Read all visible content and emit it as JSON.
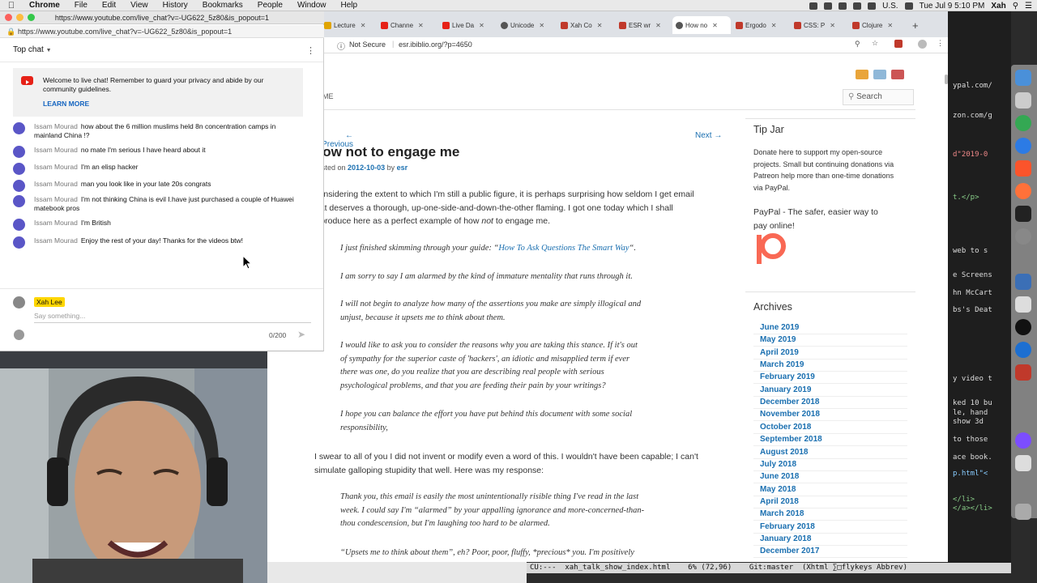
{
  "menubar": {
    "app": "Chrome",
    "items": [
      "File",
      "Edit",
      "View",
      "History",
      "Bookmarks",
      "People",
      "Window",
      "Help"
    ],
    "input_source": "U.S.",
    "clock": "Tue Jul 9  5:10 PM",
    "user": "Xah"
  },
  "chat_window": {
    "title": "https://www.youtube.com/live_chat?v=-UG622_5z80&is_popout=1",
    "url": "https://www.youtube.com/live_chat?v=-UG622_5z80&is_popout=1",
    "header": "Top chat",
    "welcome": "Welcome to live chat! Remember to guard your privacy and abide by our community guidelines.",
    "learn_more": "LEARN MORE",
    "messages": [
      {
        "author": "Issam Mourad",
        "text": "how about the 6 million muslims held 8n concentration camps in mainland China !?"
      },
      {
        "author": "Issam Mourad",
        "text": "no mate I'm serious I have heard about it"
      },
      {
        "author": "Issam Mourad",
        "text": "I'm an elisp hacker"
      },
      {
        "author": "Issam Mourad",
        "text": "man you look like in your late 20s congrats"
      },
      {
        "author": "Issam Mourad",
        "text": "I'm not thinking China is evil I.have just purchased a couple of Huawei matebook pros"
      },
      {
        "author": "Issam Mourad",
        "text": "I'm British"
      },
      {
        "author": "Issam Mourad",
        "text": "Enjoy the rest of your day! Thanks for the videos btw!"
      }
    ],
    "current_user": "Xah Lee",
    "input_placeholder": "Say something...",
    "char_count": "0/200"
  },
  "browser": {
    "tabs": [
      {
        "label": "Lecture",
        "color": "#e0a400"
      },
      {
        "label": "Channe",
        "color": "#e62117"
      },
      {
        "label": "Live Da",
        "color": "#e62117"
      },
      {
        "label": "Unicode",
        "color": "#555555"
      },
      {
        "label": "Xah Co",
        "color": "#c0392b"
      },
      {
        "label": "ESR wr",
        "color": "#c0392b"
      },
      {
        "label": "How no",
        "color": "#555555"
      },
      {
        "label": "Ergodo",
        "color": "#c0392b"
      },
      {
        "label": "CSS: P",
        "color": "#c0392b"
      },
      {
        "label": "Clojure",
        "color": "#c0392b"
      }
    ],
    "security": "Not Secure",
    "url": "esr.ibiblio.org/?p=4650"
  },
  "blog": {
    "nav_partial": "ME",
    "search_label": "Search",
    "prev": "← Previous",
    "next": "Next →",
    "title": "How not to engage me",
    "posted_prefix": "Posted on",
    "date": "2012-10-03",
    "by": "by",
    "author": "esr",
    "intro_1": "Considering the extent to which I'm still a public figure, it is perhaps surprising how seldom I get email",
    "intro_2": "that deserves a thorough, up-one-side-and-down-the-other flaming. I got one today which I shall",
    "intro_3_a": "reproduce here as a perfect example of how",
    "intro_3_em": "not",
    "intro_3_b": "to engage me.",
    "q1_a": "I just finished skimming through your guide: “",
    "q1_link": "How To Ask Questions The Smart Way",
    "q1_b": "“.",
    "q2": "I am sorry to say I am alarmed by the kind of immature mentality that runs through it.",
    "q3_1": "I will not begin to analyze how many of the assertions you make are simply illogical and",
    "q3_2": "unjust, because it upsets me to think about them.",
    "q4_1": "I would like to ask you to consider the reasons why you are taking this stance. If it's out",
    "q4_2": "of sympathy for the superior caste of 'hackers', an idiotic and misapplied term if ever",
    "q4_3": "there was one, do you realize that you are describing real people with serious",
    "q4_4": "psychological problems, and that you are feeding their pain by your writings?",
    "q5_1": "I hope you can balance the effort you have put behind this document with some social",
    "q5_2": "responsibility,",
    "body_1": "I swear to all of you I did not invent or modify even a word of this. I wouldn't have been capable; I can't",
    "body_2": "simulate galloping stupidity that well. Here was my response:",
    "r1_1": "Thank you, this email is easily the most unintentionally risible thing I've read in the last",
    "r1_2": "week. I could say I'm “alarmed” by your appalling ignorance and more-concerned-than-",
    "r1_3": "thou condescension, but I'm laughing too hard to be alarmed.",
    "r2_1": "“Upsets me to think about them”, eh? Poor, poor, fluffy, *precious* you. I'm positively"
  },
  "sidebar": {
    "tip_jar_title": "Tip Jar",
    "tip_jar_text_1": "Donate here to support my open-source",
    "tip_jar_text_2": "projects. Small but continuing donations via",
    "tip_jar_text_3": "Patreon help more than one-time donations",
    "tip_jar_text_4": "via PayPal.",
    "paypal_alt_1": "PayPal - The safer, easier way to",
    "paypal_alt_2": "pay online!",
    "archives_title": "Archives",
    "archives": [
      "June 2019",
      "May 2019",
      "April 2019",
      "March 2019",
      "February 2019",
      "January 2019",
      "December 2018",
      "November 2018",
      "October 2018",
      "September 2018",
      "August 2018",
      "July 2018",
      "June 2018",
      "May 2018",
      "April 2018",
      "March 2018",
      "February 2018",
      "January 2018",
      "December 2017"
    ]
  },
  "emacs": {
    "lines": [
      "zon.com/g",
      "ypal.com/",
      "d\"2019-0",
      "t.</p>",
      "web to s",
      "e Screens",
      "hn McCart",
      "bs's Deat",
      "y video t",
      "ked 10 bu",
      "le, hand",
      " show 3d",
      "to those",
      "ace book.",
      "p.html\"<",
      "</li>",
      "</a></li>"
    ],
    "modeline": "CU:---  xah_talk_show_index.html    6% (72,96)    Git:master  (Xhtml ∑□flykeys Abbrev)"
  },
  "colors": {
    "youtube_red": "#e62117",
    "link_blue": "#1a6fb0",
    "patreon": "#f96854",
    "user_badge": "#ffd600",
    "avatar": "#5a56c7"
  }
}
